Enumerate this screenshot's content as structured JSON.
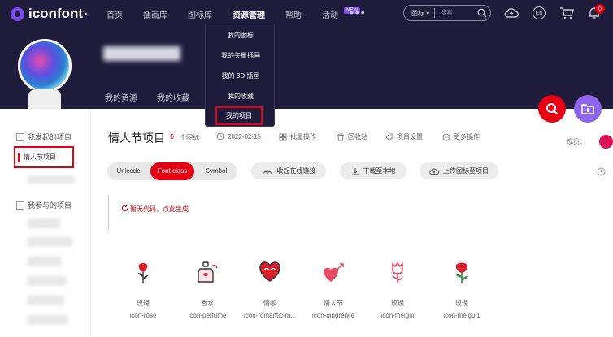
{
  "brand": {
    "name": "iconfont"
  },
  "nav": {
    "items": [
      {
        "label": "首页"
      },
      {
        "label": "插画库"
      },
      {
        "label": "图标库"
      },
      {
        "label": "资源管理"
      },
      {
        "label": "帮助"
      },
      {
        "label": "活动"
      }
    ],
    "badge": "NEW",
    "more": "•••"
  },
  "search": {
    "scope": "图标",
    "placeholder": "搜索"
  },
  "header": {
    "lang": "En",
    "cart_count": "0"
  },
  "profile": {
    "tabs": [
      "我的资源",
      "我的收藏"
    ]
  },
  "dropdown": {
    "items": [
      "我的图标",
      "我的矢量插画",
      "我的 3D 插画",
      "我的收藏",
      "我的项目"
    ]
  },
  "sidebar": {
    "my_projects": "我发起的项目",
    "selected_project": "情人节项目",
    "joined_projects": "我参与的项目"
  },
  "project": {
    "title": "情人节项目",
    "icon_count": "6",
    "icon_count_label": "个图标",
    "date": "2022-02-15",
    "batch": "批量操作",
    "recycle": "回收站",
    "settings": "项目设置",
    "more": "更多操作",
    "members": "成员："
  },
  "toolbar": {
    "formats": [
      "Unicode",
      "Font class",
      "Symbol"
    ],
    "selected_format": "Font class",
    "collapse_link": "收起在线链接",
    "download": "下载至本地",
    "upload": "上传图标至项目"
  },
  "codebox": {
    "message": "暂无代码，点此生成"
  },
  "icons": [
    {
      "name": "玫瑰",
      "code": "icon-rose",
      "icon": "rose-icon"
    },
    {
      "name": "香水",
      "code": "icon-perfume",
      "icon": "perfume-icon"
    },
    {
      "name": "情歌",
      "code": "icon-romantic-m...",
      "icon": "heart-music-icon"
    },
    {
      "name": "情人节",
      "code": "icon-qingrenjie",
      "icon": "heart-arrow-icon"
    },
    {
      "name": "玫瑰",
      "code": "icon-meigui",
      "icon": "rose-outline-icon"
    },
    {
      "name": "玫瑰",
      "code": "icon-meigui1",
      "icon": "rose-red-icon"
    }
  ],
  "colors": {
    "header_bg": "#1f1b3b",
    "accent": "#e60012",
    "purple": "#8e66ec"
  }
}
